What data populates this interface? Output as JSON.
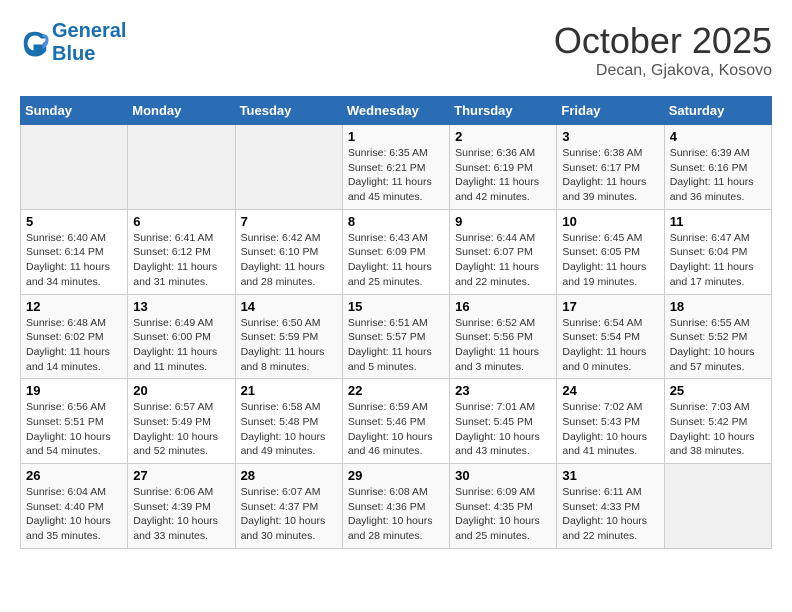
{
  "header": {
    "logo_line1": "General",
    "logo_line2": "Blue",
    "month": "October 2025",
    "location": "Decan, Gjakova, Kosovo"
  },
  "weekdays": [
    "Sunday",
    "Monday",
    "Tuesday",
    "Wednesday",
    "Thursday",
    "Friday",
    "Saturday"
  ],
  "weeks": [
    [
      {
        "day": "",
        "info": ""
      },
      {
        "day": "",
        "info": ""
      },
      {
        "day": "",
        "info": ""
      },
      {
        "day": "1",
        "info": "Sunrise: 6:35 AM\nSunset: 6:21 PM\nDaylight: 11 hours and 45 minutes."
      },
      {
        "day": "2",
        "info": "Sunrise: 6:36 AM\nSunset: 6:19 PM\nDaylight: 11 hours and 42 minutes."
      },
      {
        "day": "3",
        "info": "Sunrise: 6:38 AM\nSunset: 6:17 PM\nDaylight: 11 hours and 39 minutes."
      },
      {
        "day": "4",
        "info": "Sunrise: 6:39 AM\nSunset: 6:16 PM\nDaylight: 11 hours and 36 minutes."
      }
    ],
    [
      {
        "day": "5",
        "info": "Sunrise: 6:40 AM\nSunset: 6:14 PM\nDaylight: 11 hours and 34 minutes."
      },
      {
        "day": "6",
        "info": "Sunrise: 6:41 AM\nSunset: 6:12 PM\nDaylight: 11 hours and 31 minutes."
      },
      {
        "day": "7",
        "info": "Sunrise: 6:42 AM\nSunset: 6:10 PM\nDaylight: 11 hours and 28 minutes."
      },
      {
        "day": "8",
        "info": "Sunrise: 6:43 AM\nSunset: 6:09 PM\nDaylight: 11 hours and 25 minutes."
      },
      {
        "day": "9",
        "info": "Sunrise: 6:44 AM\nSunset: 6:07 PM\nDaylight: 11 hours and 22 minutes."
      },
      {
        "day": "10",
        "info": "Sunrise: 6:45 AM\nSunset: 6:05 PM\nDaylight: 11 hours and 19 minutes."
      },
      {
        "day": "11",
        "info": "Sunrise: 6:47 AM\nSunset: 6:04 PM\nDaylight: 11 hours and 17 minutes."
      }
    ],
    [
      {
        "day": "12",
        "info": "Sunrise: 6:48 AM\nSunset: 6:02 PM\nDaylight: 11 hours and 14 minutes."
      },
      {
        "day": "13",
        "info": "Sunrise: 6:49 AM\nSunset: 6:00 PM\nDaylight: 11 hours and 11 minutes."
      },
      {
        "day": "14",
        "info": "Sunrise: 6:50 AM\nSunset: 5:59 PM\nDaylight: 11 hours and 8 minutes."
      },
      {
        "day": "15",
        "info": "Sunrise: 6:51 AM\nSunset: 5:57 PM\nDaylight: 11 hours and 5 minutes."
      },
      {
        "day": "16",
        "info": "Sunrise: 6:52 AM\nSunset: 5:56 PM\nDaylight: 11 hours and 3 minutes."
      },
      {
        "day": "17",
        "info": "Sunrise: 6:54 AM\nSunset: 5:54 PM\nDaylight: 11 hours and 0 minutes."
      },
      {
        "day": "18",
        "info": "Sunrise: 6:55 AM\nSunset: 5:52 PM\nDaylight: 10 hours and 57 minutes."
      }
    ],
    [
      {
        "day": "19",
        "info": "Sunrise: 6:56 AM\nSunset: 5:51 PM\nDaylight: 10 hours and 54 minutes."
      },
      {
        "day": "20",
        "info": "Sunrise: 6:57 AM\nSunset: 5:49 PM\nDaylight: 10 hours and 52 minutes."
      },
      {
        "day": "21",
        "info": "Sunrise: 6:58 AM\nSunset: 5:48 PM\nDaylight: 10 hours and 49 minutes."
      },
      {
        "day": "22",
        "info": "Sunrise: 6:59 AM\nSunset: 5:46 PM\nDaylight: 10 hours and 46 minutes."
      },
      {
        "day": "23",
        "info": "Sunrise: 7:01 AM\nSunset: 5:45 PM\nDaylight: 10 hours and 43 minutes."
      },
      {
        "day": "24",
        "info": "Sunrise: 7:02 AM\nSunset: 5:43 PM\nDaylight: 10 hours and 41 minutes."
      },
      {
        "day": "25",
        "info": "Sunrise: 7:03 AM\nSunset: 5:42 PM\nDaylight: 10 hours and 38 minutes."
      }
    ],
    [
      {
        "day": "26",
        "info": "Sunrise: 6:04 AM\nSunset: 4:40 PM\nDaylight: 10 hours and 35 minutes."
      },
      {
        "day": "27",
        "info": "Sunrise: 6:06 AM\nSunset: 4:39 PM\nDaylight: 10 hours and 33 minutes."
      },
      {
        "day": "28",
        "info": "Sunrise: 6:07 AM\nSunset: 4:37 PM\nDaylight: 10 hours and 30 minutes."
      },
      {
        "day": "29",
        "info": "Sunrise: 6:08 AM\nSunset: 4:36 PM\nDaylight: 10 hours and 28 minutes."
      },
      {
        "day": "30",
        "info": "Sunrise: 6:09 AM\nSunset: 4:35 PM\nDaylight: 10 hours and 25 minutes."
      },
      {
        "day": "31",
        "info": "Sunrise: 6:11 AM\nSunset: 4:33 PM\nDaylight: 10 hours and 22 minutes."
      },
      {
        "day": "",
        "info": ""
      }
    ]
  ]
}
